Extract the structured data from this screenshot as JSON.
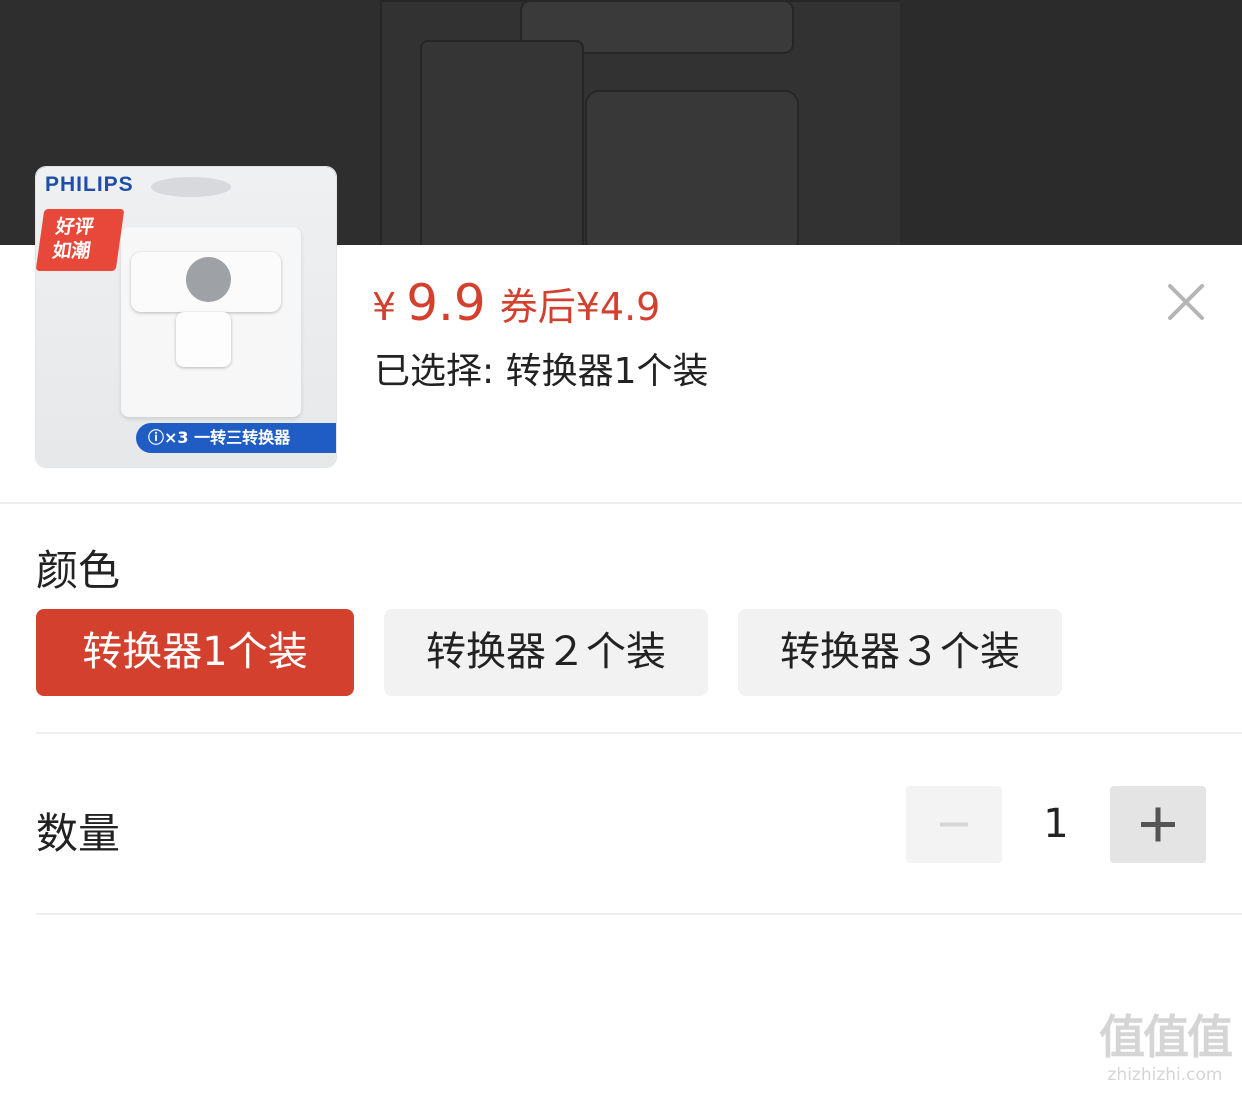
{
  "product": {
    "brand": "PHILIPS",
    "badge": "好评\n如潮",
    "banner": "ⓘ×3 一转三转换器"
  },
  "price": {
    "currency": "¥",
    "amount": "9.9",
    "coupon_text": "券后¥4.9",
    "accent_color": "#d3402e"
  },
  "selection": {
    "label": "已选择: 转换器1个装"
  },
  "color_section": {
    "title": "颜色",
    "options": [
      {
        "label": "转换器1个装",
        "selected": true
      },
      {
        "label": "转换器２个装",
        "selected": false
      },
      {
        "label": "转换器３个装",
        "selected": false
      }
    ]
  },
  "quantity_section": {
    "title": "数量",
    "value": "1"
  },
  "watermark": {
    "main": "值值值",
    "site": "zhizhizhi.com"
  },
  "icons": {
    "close": "close-icon",
    "minus": "minus-icon",
    "plus": "plus-icon"
  }
}
